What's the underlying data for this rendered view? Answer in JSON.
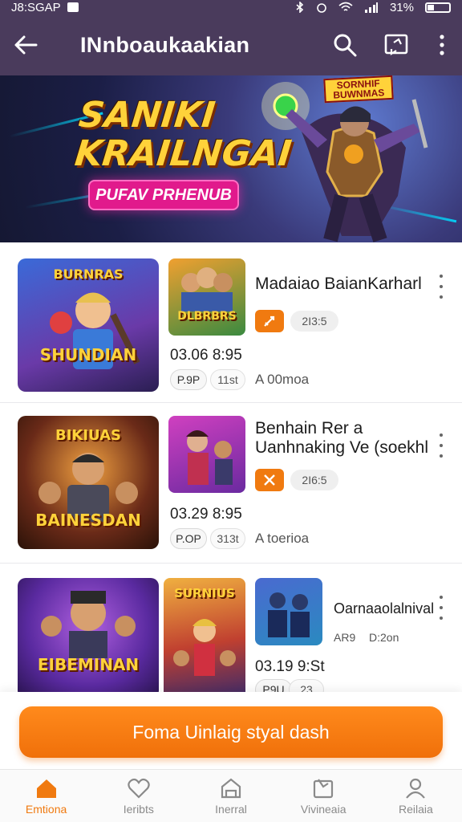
{
  "status_bar": {
    "time": "J8:SGAP",
    "battery": "31%"
  },
  "app_bar": {
    "title": "INnboaukaakian"
  },
  "hero": {
    "title_line1": "SANIKI",
    "title_line2": "KRAILNGAI",
    "cta_label": "PUFAV PRHENUB",
    "sign_text": "SORNHIF BUWNMAS"
  },
  "rows": [
    {
      "title": "Madaiao BaianKarharl",
      "thumb_big_label": "SHUNDIAN",
      "thumb_big_top": "BURNRAS",
      "thumb_small_label": "DLBRBRS",
      "chip_value": "2I3:5",
      "time": "03.06 8:95",
      "tag1": "P.9P",
      "tag2": "11st",
      "subtitle": "A 00moa"
    },
    {
      "title_line1": "Benhain Rer a",
      "title_line2": "Uanhnaking Ve (soekhl",
      "thumb_big_label": "BAINESDAN",
      "thumb_big_top": "BIKIUAS",
      "chip_value": "2I6:5",
      "time": "03.29 8:95",
      "tag1": "P.OP",
      "tag2": "313t",
      "subtitle": "A toerioa"
    },
    {
      "title": "Oarnaaolalnival",
      "thumb_big_label": "EIBEMINAN",
      "thumb_mid_label": "SURNIUS",
      "chip_a": "AR9",
      "chip_b": "D:2on",
      "time": "03.19 9:St",
      "tag1": "P9U",
      "tag2": "23"
    }
  ],
  "cta": {
    "label": "Foma Uinlaig styal dash"
  },
  "nav": [
    {
      "label": "Emtiona"
    },
    {
      "label": "Ieribts"
    },
    {
      "label": "Inerral"
    },
    {
      "label": "Vivineaia"
    },
    {
      "label": "Reilaia"
    }
  ],
  "colors": {
    "app_bar": "#4a3b5c",
    "accent": "#f07a10",
    "hero_cta": "#e11a8c"
  }
}
